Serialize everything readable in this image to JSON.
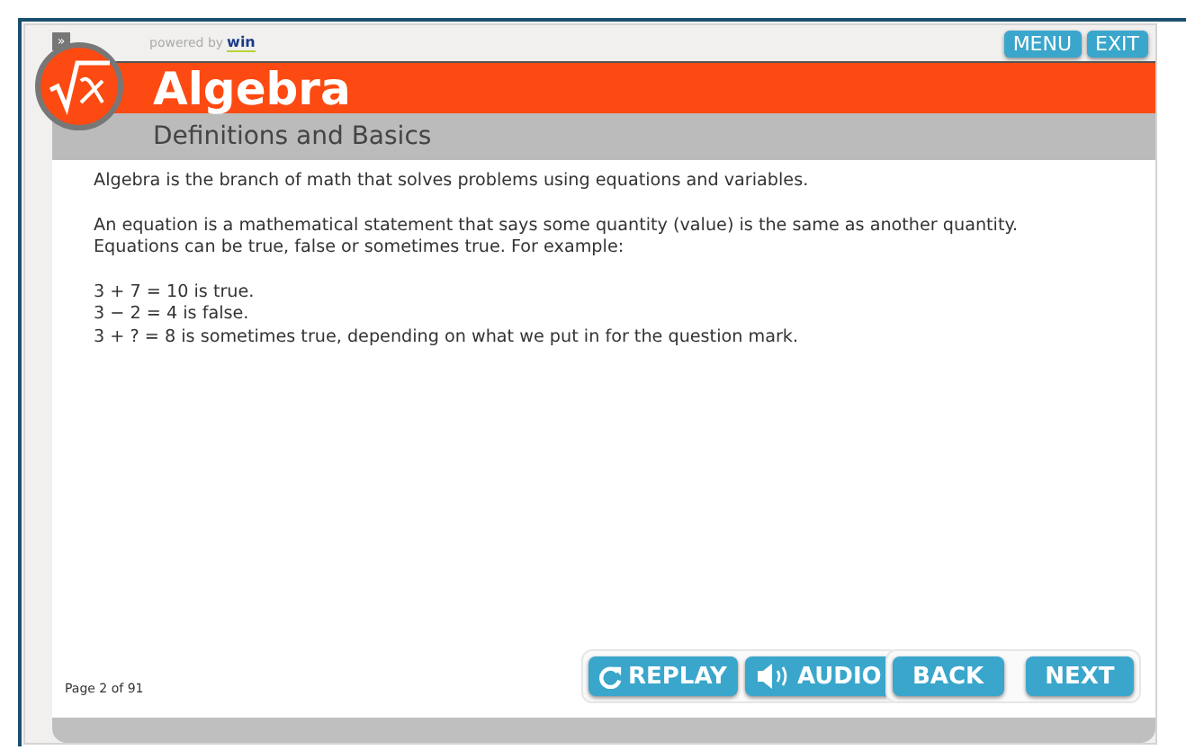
{
  "toggle": "»",
  "branding": {
    "prefix": "powered by",
    "logo": "win"
  },
  "top_buttons": [
    "MENU",
    "EXIT"
  ],
  "course": {
    "title": "Algebra",
    "subtitle": "Definitions and Basics"
  },
  "paragraphs": [
    [
      "Algebra is the branch of math that solves problems using equations and variables."
    ],
    [
      "An equation is a mathematical statement that says some quantity (value) is the same as another quantity.",
      "Equations can be true, false or sometimes true. For example:"
    ],
    [
      "3 + 7 = 10 is true.",
      "3 − 2 = 4 is false.",
      "3 + ? = 8 is sometimes true, depending on what we put in for the question mark."
    ]
  ],
  "page_indicator": "Page 2 of 91",
  "media_buttons": [
    {
      "kind": "replay",
      "label": "REPLAY"
    },
    {
      "kind": "audio",
      "label": "AUDIO"
    }
  ],
  "nav_buttons": [
    "BACK",
    "NEXT"
  ]
}
